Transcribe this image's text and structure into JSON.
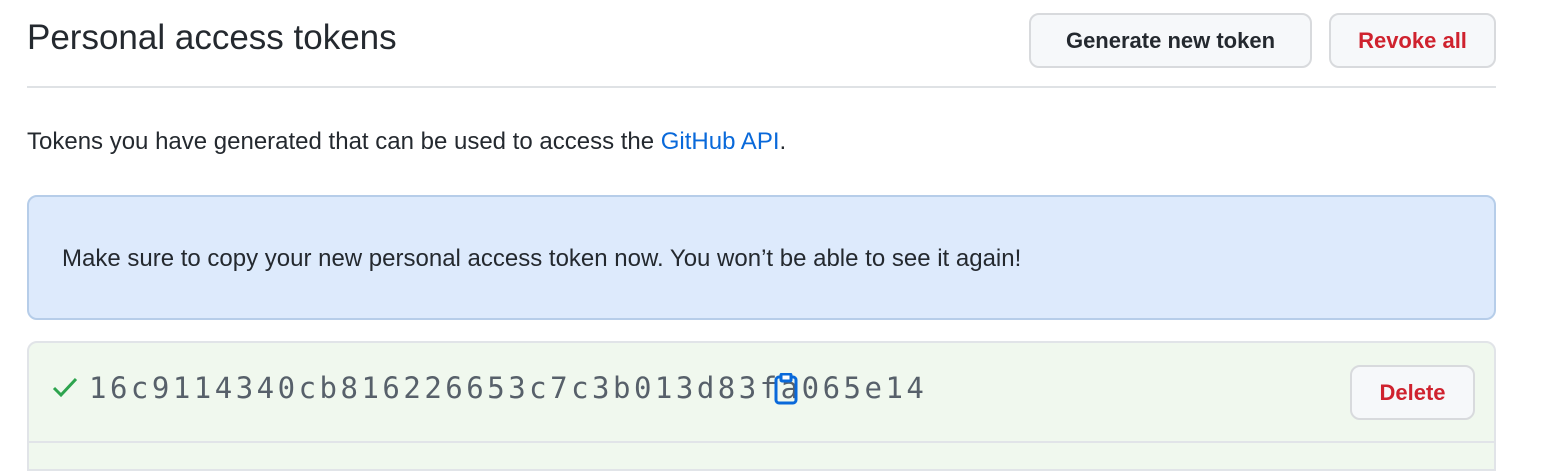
{
  "header": {
    "title": "Personal access tokens",
    "generate_label": "Generate new token",
    "revoke_label": "Revoke all"
  },
  "intro": {
    "text": "Tokens you have generated that can be used to access the ",
    "link": "GitHub API",
    "suffix": "."
  },
  "flash": {
    "message": "Make sure to copy your new personal access token now. You won’t be able to see it again!"
  },
  "token": {
    "value": "16c9114340cb816226653c7c3b013d83fa065e14",
    "delete_label": "Delete",
    "status_icon": "check-icon",
    "copy_icon": "clipboard-icon"
  },
  "colors": {
    "link": "#0969da",
    "danger": "#cf222e",
    "success": "#2da44e",
    "flash_bg": "#ddeafc",
    "token_bg": "#f0f8ee"
  }
}
